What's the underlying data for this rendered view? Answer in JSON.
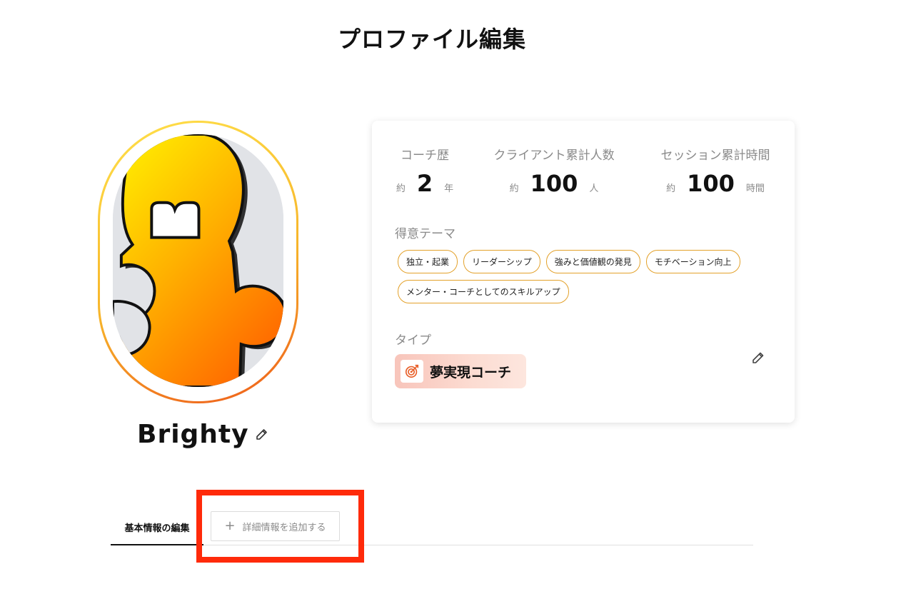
{
  "page": {
    "title": "プロファイル編集"
  },
  "profile": {
    "name": "Brighty"
  },
  "stats": {
    "coach_years": {
      "label": "コーチ歴",
      "prefix": "約",
      "value": "2",
      "unit": "年"
    },
    "clients": {
      "label": "クライアント累計人数",
      "prefix": "約",
      "value": "100",
      "unit": "人"
    },
    "session_hours": {
      "label": "セッション累計時間",
      "prefix": "約",
      "value": "100",
      "unit": "時間"
    }
  },
  "themes": {
    "label": "得意テーマ",
    "items": [
      "独立・起業",
      "リーダーシップ",
      "強みと価値観の発見",
      "モチベーション向上",
      "メンター・コーチとしてのスキルアップ"
    ]
  },
  "type": {
    "label": "タイプ",
    "value": "夢実現コーチ",
    "icon": "target-icon"
  },
  "tabs": {
    "basic": "基本情報の編集",
    "add_detail": "詳細情報を追加する"
  },
  "colors": {
    "accent_orange": "#e3a12a",
    "highlight_red": "#ff2a0a",
    "avatar_yellow": "#ffe14a",
    "avatar_orange": "#ee5a1a"
  }
}
